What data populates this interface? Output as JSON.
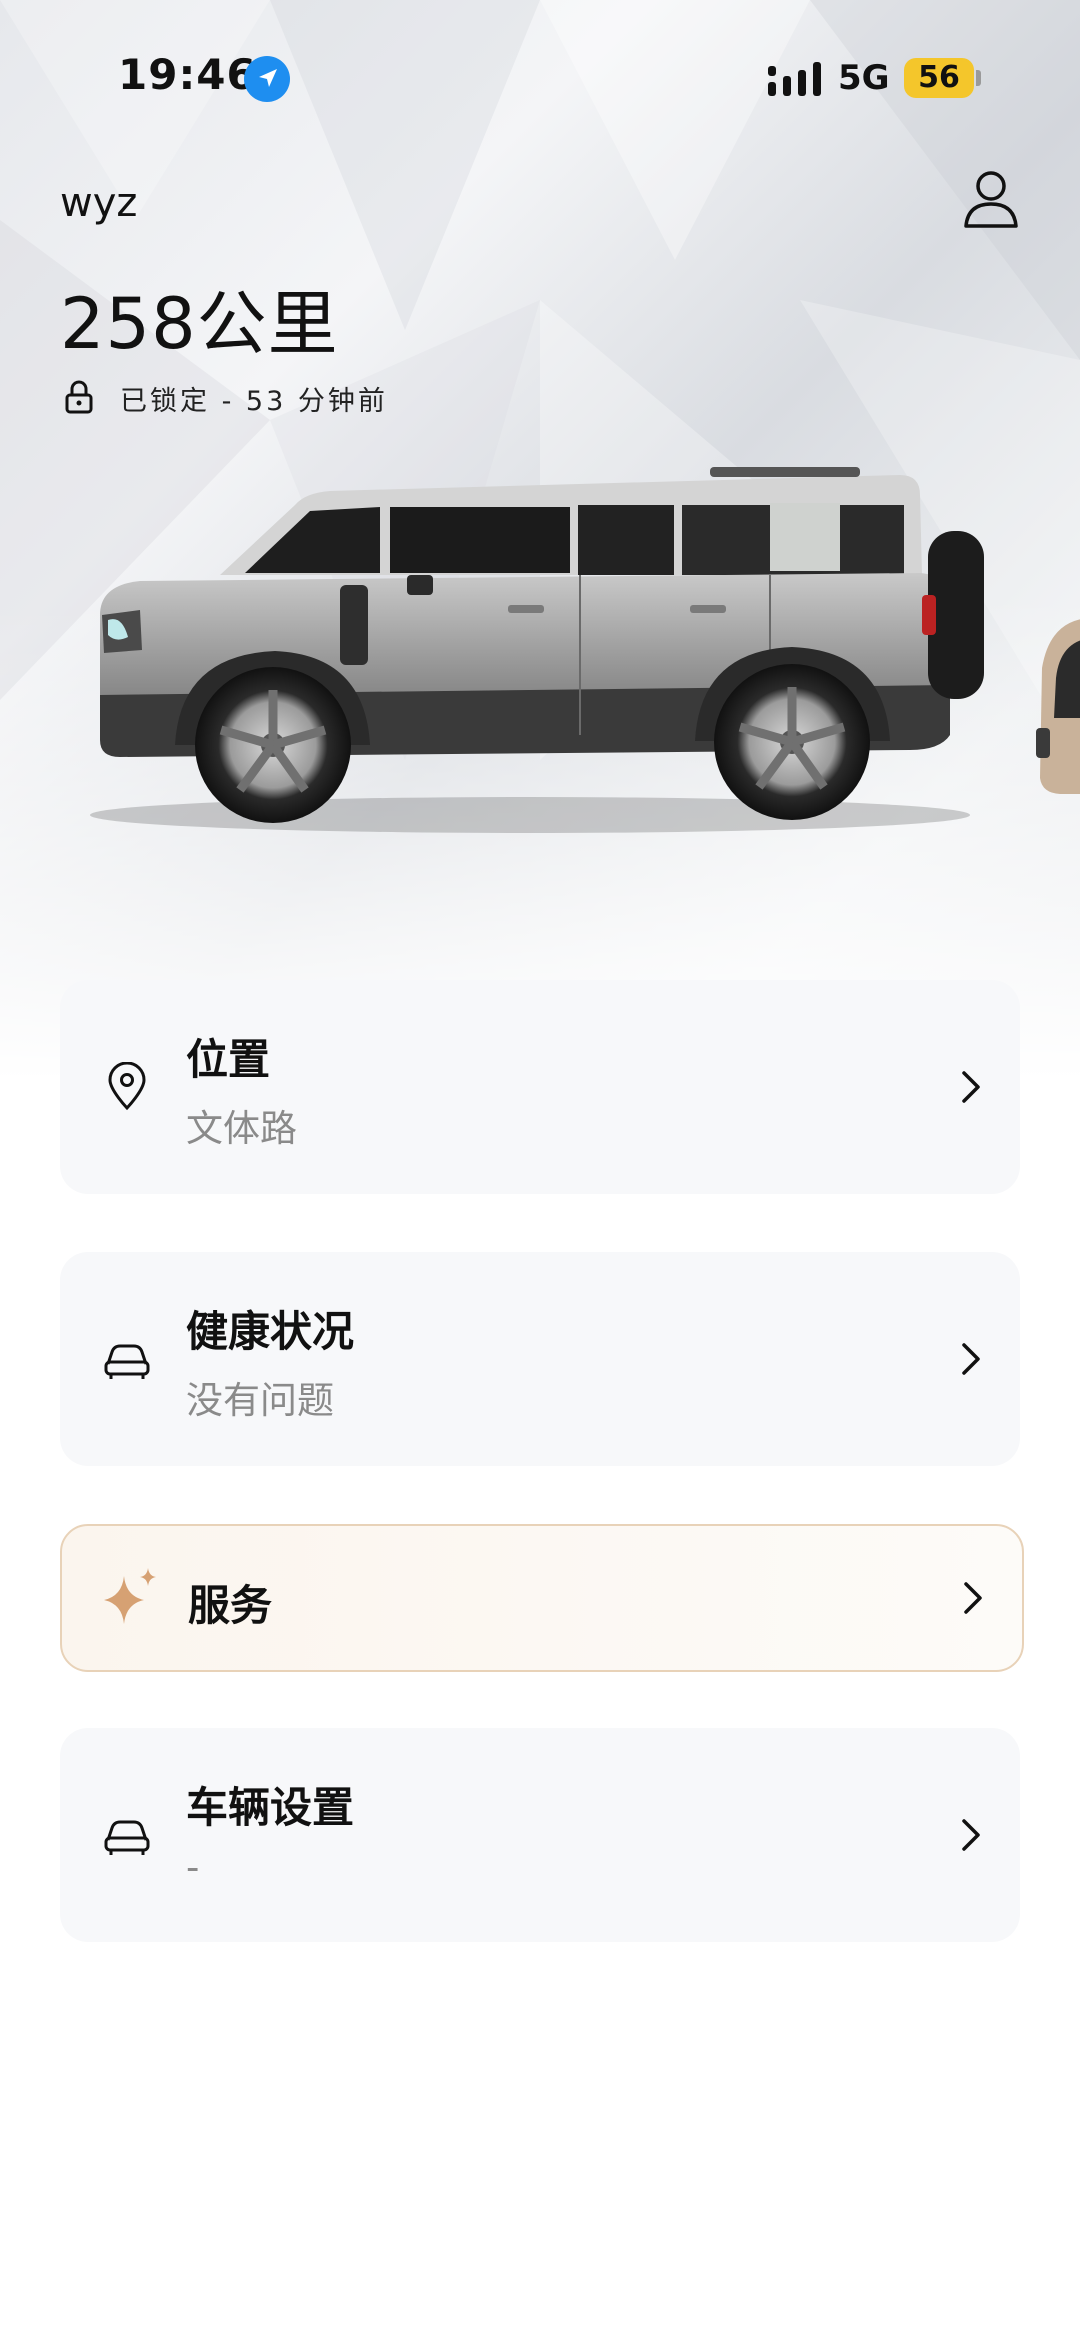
{
  "status_bar": {
    "time": "19:46",
    "network": "5G",
    "battery": "56"
  },
  "header": {
    "username": "wyz",
    "range": "258公里",
    "lock_status": "已锁定 - 53 分钟前"
  },
  "cards": {
    "location": {
      "title": "位置",
      "subtitle": "文体路",
      "icon": "location-pin-icon"
    },
    "health": {
      "title": "健康状况",
      "subtitle": "没有问题",
      "icon": "car-icon"
    },
    "service": {
      "title": "服务",
      "icon": "sparkle-icon"
    },
    "settings": {
      "title": "车辆设置",
      "subtitle": "-",
      "icon": "car-icon"
    }
  },
  "colors": {
    "accent_location": "#1e8ef0",
    "battery": "#f4c62b",
    "service_sparkle": "#d6a173",
    "service_border": "#e8d2b8"
  }
}
